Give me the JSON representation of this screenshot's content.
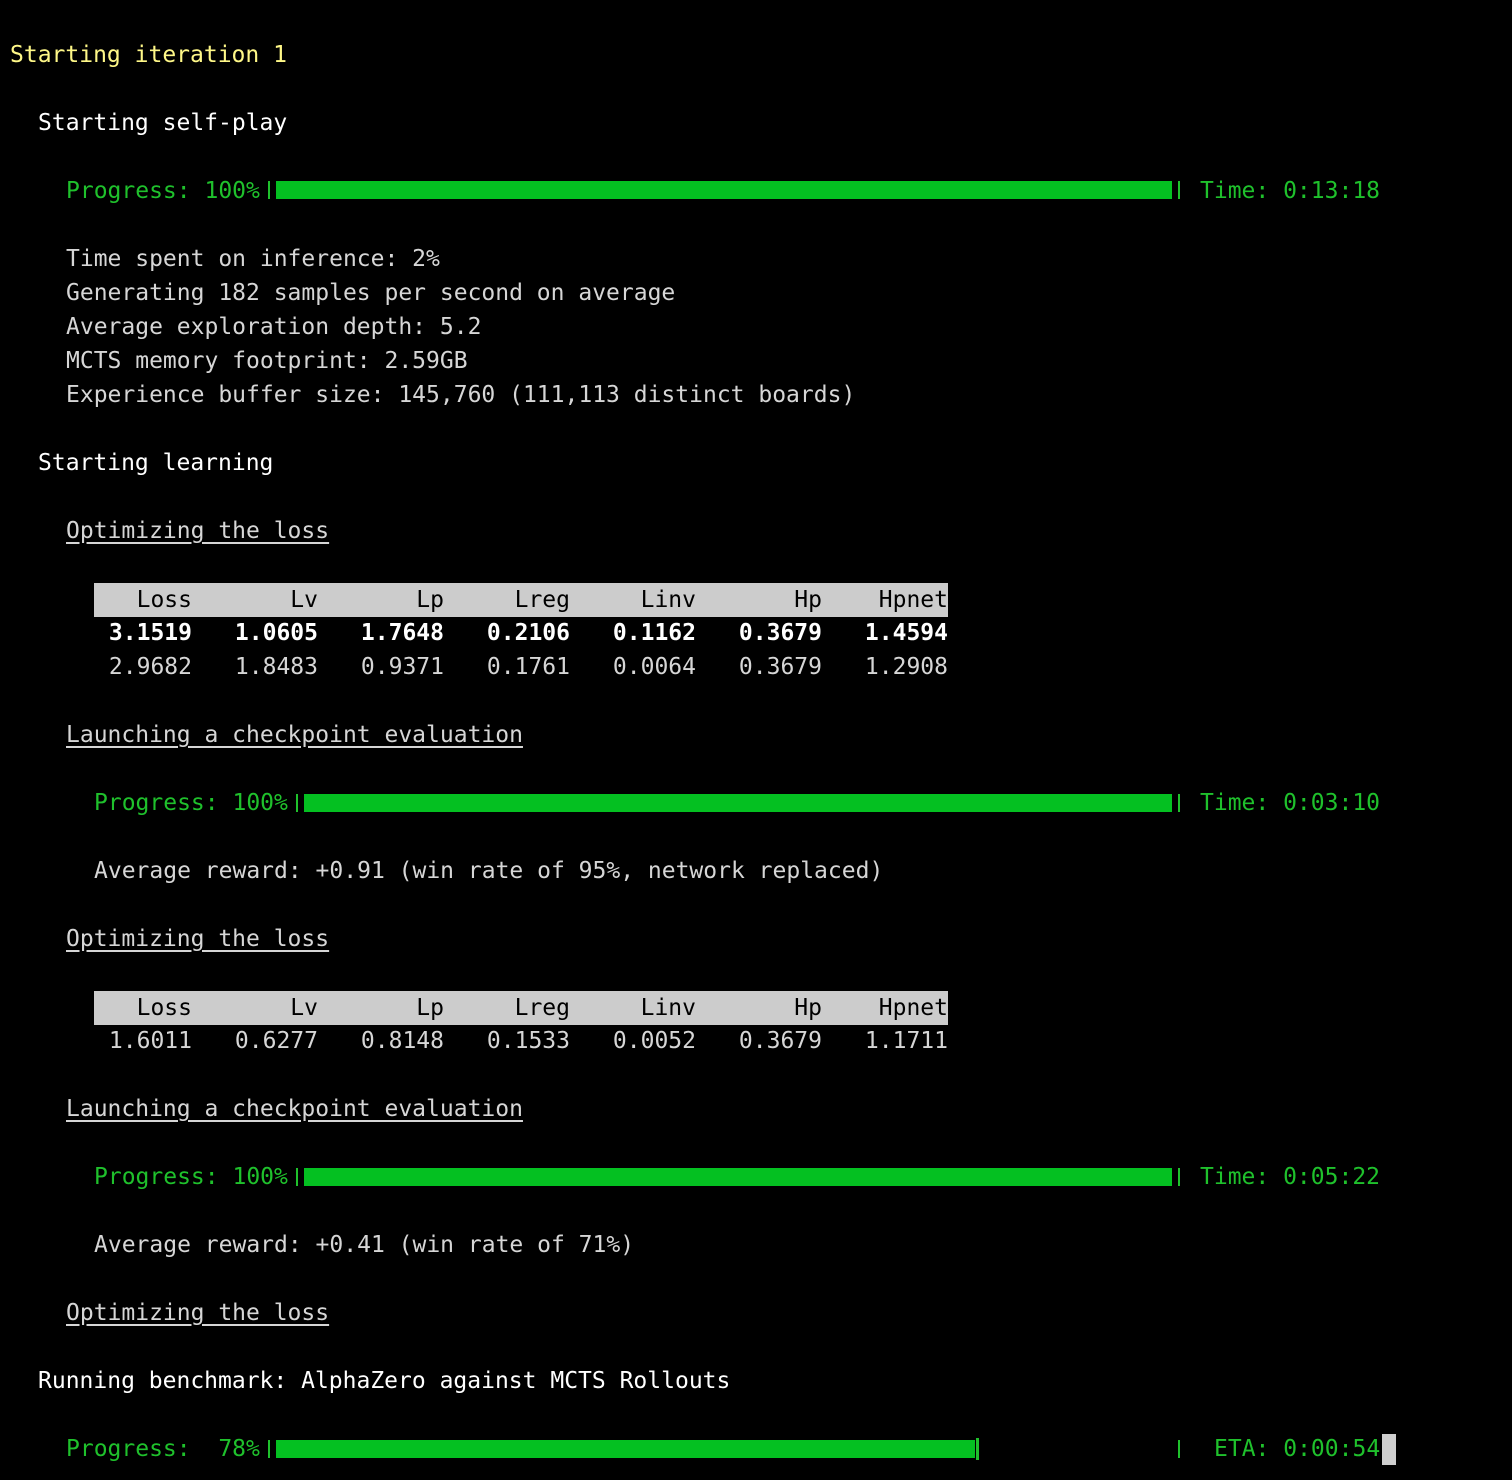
{
  "iteration_title": "Starting iteration 1",
  "selfplay": {
    "title": "Starting self-play",
    "progress_label": "Progress: 100%",
    "progress_fraction": 1.0,
    "time_label": "Time: 0:13:18",
    "stats": [
      "Time spent on inference: 2%",
      "Generating 182 samples per second on average",
      "Average exploration depth: 5.2",
      "MCTS memory footprint: 2.59GB",
      "Experience buffer size: 145,760 (111,113 distinct boards)"
    ]
  },
  "learning": {
    "title": "Starting learning",
    "opt1": {
      "title": "Optimizing the loss",
      "headers": [
        "Loss",
        "Lv",
        "Lp",
        "Lreg",
        "Linv",
        "Hp",
        "Hpnet"
      ],
      "rows": [
        [
          "3.1519",
          "1.0605",
          "1.7648",
          "0.2106",
          "0.1162",
          "0.3679",
          "1.4594"
        ],
        [
          "2.9682",
          "1.8483",
          "0.9371",
          "0.1761",
          "0.0064",
          "0.3679",
          "1.2908"
        ]
      ]
    },
    "eval1": {
      "title": "Launching a checkpoint evaluation",
      "progress_label": "Progress: 100%",
      "progress_fraction": 1.0,
      "time_label": "Time: 0:03:10",
      "result": "Average reward: +0.91 (win rate of 95%, network replaced)"
    },
    "opt2": {
      "title": "Optimizing the loss",
      "headers": [
        "Loss",
        "Lv",
        "Lp",
        "Lreg",
        "Linv",
        "Hp",
        "Hpnet"
      ],
      "rows": [
        [
          "1.6011",
          "0.6277",
          "0.8148",
          "0.1533",
          "0.0052",
          "0.3679",
          "1.1711"
        ]
      ]
    },
    "eval2": {
      "title": "Launching a checkpoint evaluation",
      "progress_label": "Progress: 100%",
      "progress_fraction": 1.0,
      "time_label": "Time: 0:05:22",
      "result": "Average reward: +0.41 (win rate of 71%)"
    },
    "opt3": {
      "title": "Optimizing the loss"
    }
  },
  "benchmark": {
    "title": "Running benchmark: AlphaZero against MCTS Rollouts",
    "progress_label": "Progress:  78%",
    "progress_fraction": 0.78,
    "eta_label": "ETA: 0:00:54"
  },
  "colors": {
    "background": "#000000",
    "progress_green": "#04c021",
    "title_yellow": "#fff888",
    "table_header_bg": "#cccccc"
  }
}
